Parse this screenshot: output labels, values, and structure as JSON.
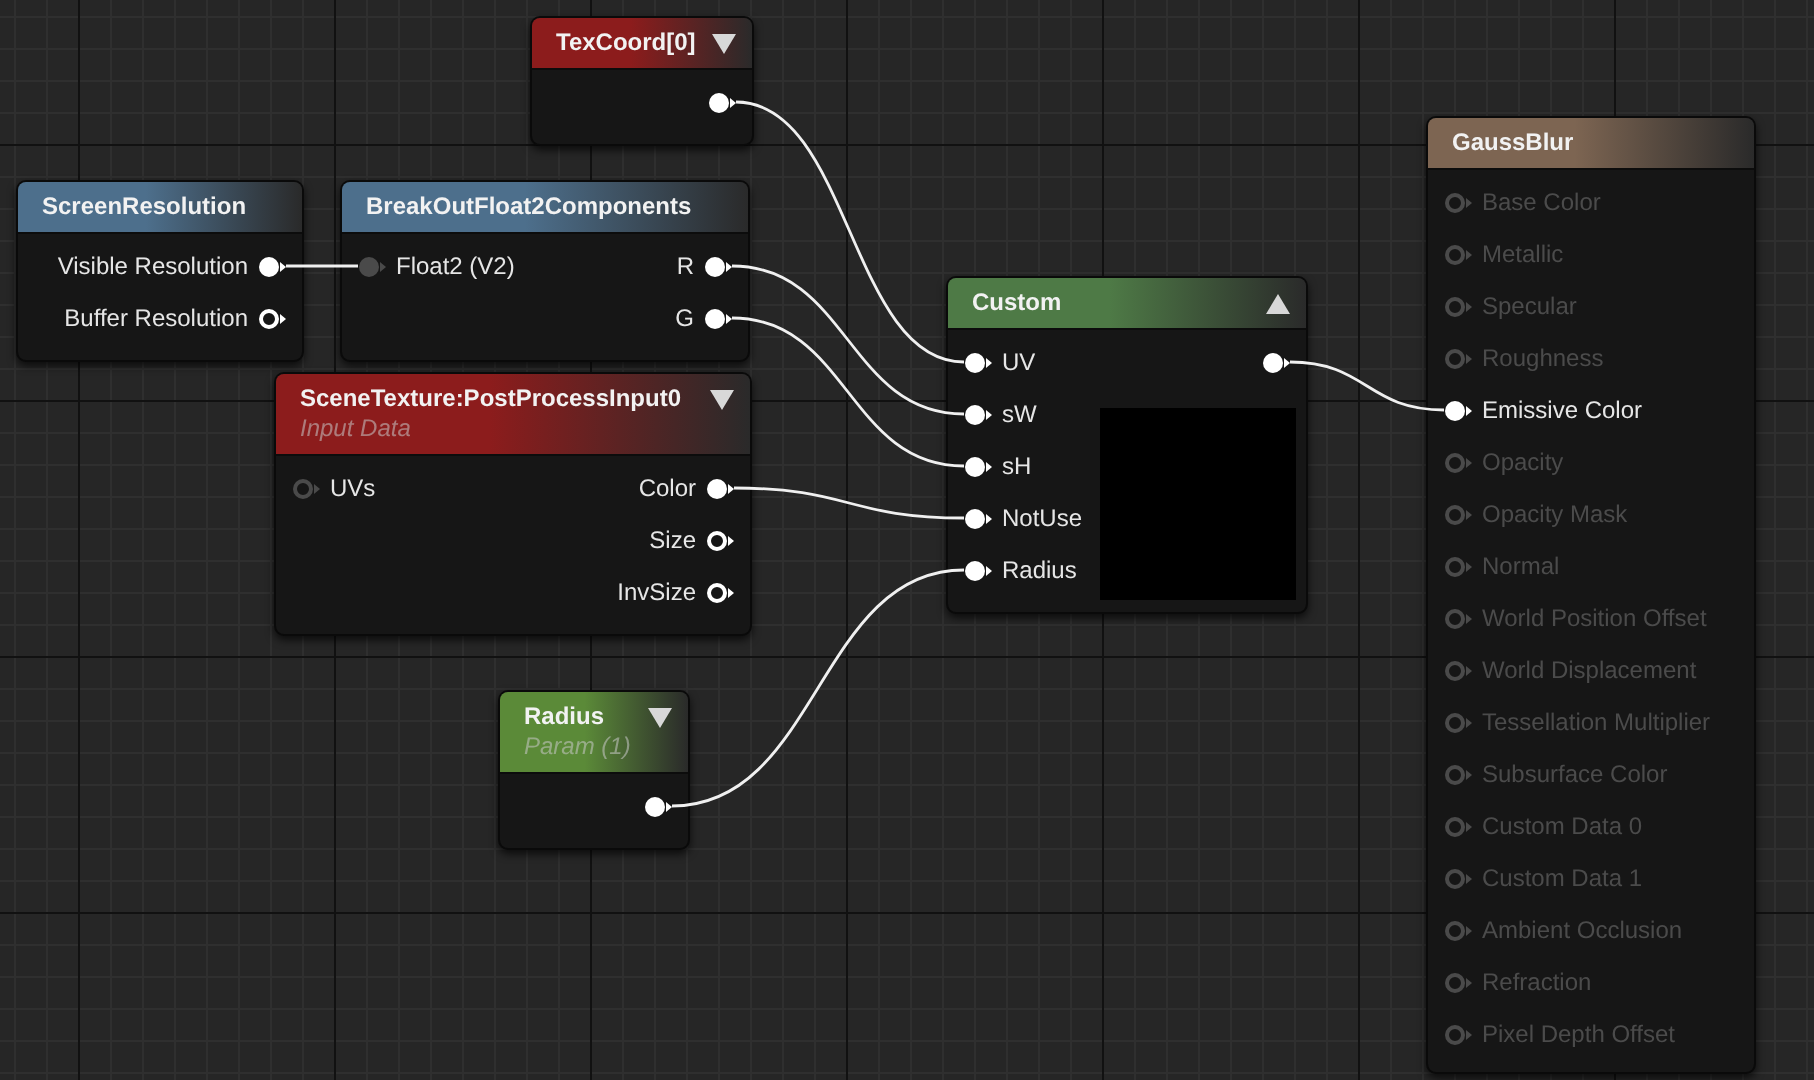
{
  "nodes": [
    {
      "title": "TexCoord[0]",
      "color": "#8c1c1c",
      "expanded": false,
      "outputs": [
        {
          "connected": true
        }
      ]
    },
    {
      "title": "ScreenResolution",
      "color": "#4d6f8c",
      "outputs": [
        {
          "label": "Visible Resolution",
          "connected": true
        },
        {
          "label": "Buffer Resolution",
          "connected": false
        }
      ]
    },
    {
      "title": "BreakOutFloat2Components",
      "color": "#4d6f8c",
      "inputs": [
        {
          "label": "Float2 (V2)",
          "connected": true,
          "faded": true
        }
      ],
      "outputs": [
        {
          "label": "R",
          "connected": true
        },
        {
          "label": "G",
          "connected": true
        }
      ]
    },
    {
      "title": "SceneTexture:PostProcessInput0",
      "subtitle": "Input Data",
      "color": "#8c1c1c",
      "expanded": false,
      "inputs": [
        {
          "label": "UVs",
          "connected": false,
          "faded": true
        }
      ],
      "outputs": [
        {
          "label": "Color",
          "connected": true
        },
        {
          "label": "Size",
          "connected": false
        },
        {
          "label": "InvSize",
          "connected": false
        }
      ]
    },
    {
      "title": "Custom",
      "color": "#4e7a46",
      "expanded": true,
      "preview": true,
      "inputs": [
        {
          "label": "UV",
          "connected": true
        },
        {
          "label": "sW",
          "connected": true
        },
        {
          "label": "sH",
          "connected": true
        },
        {
          "label": "NotUse",
          "connected": true
        },
        {
          "label": "Radius",
          "connected": true
        }
      ],
      "outputs": [
        {
          "connected": true
        }
      ]
    },
    {
      "title": "Radius",
      "subtitle": "Param (1)",
      "color": "#5b8a38",
      "expanded": false,
      "outputs": [
        {
          "connected": true
        }
      ]
    },
    {
      "title": "GaussBlur",
      "color": "#7d6552",
      "inputs": [
        {
          "label": "Base Color",
          "connected": false,
          "disabled": true
        },
        {
          "label": "Metallic",
          "connected": false,
          "disabled": true
        },
        {
          "label": "Specular",
          "connected": false,
          "disabled": true
        },
        {
          "label": "Roughness",
          "connected": false,
          "disabled": true
        },
        {
          "label": "Emissive Color",
          "connected": true,
          "disabled": false
        },
        {
          "label": "Opacity",
          "connected": false,
          "disabled": true
        },
        {
          "label": "Opacity Mask",
          "connected": false,
          "disabled": true
        },
        {
          "label": "Normal",
          "connected": false,
          "disabled": true
        },
        {
          "label": "World Position Offset",
          "connected": false,
          "disabled": true
        },
        {
          "label": "World Displacement",
          "connected": false,
          "disabled": true
        },
        {
          "label": "Tessellation Multiplier",
          "connected": false,
          "disabled": true
        },
        {
          "label": "Subsurface Color",
          "connected": false,
          "disabled": true
        },
        {
          "label": "Custom Data 0",
          "connected": false,
          "disabled": true
        },
        {
          "label": "Custom Data 1",
          "connected": false,
          "disabled": true
        },
        {
          "label": "Ambient Occlusion",
          "connected": false,
          "disabled": true
        },
        {
          "label": "Refraction",
          "connected": false,
          "disabled": true
        },
        {
          "label": "Pixel Depth Offset",
          "connected": false,
          "disabled": true
        }
      ]
    }
  ]
}
